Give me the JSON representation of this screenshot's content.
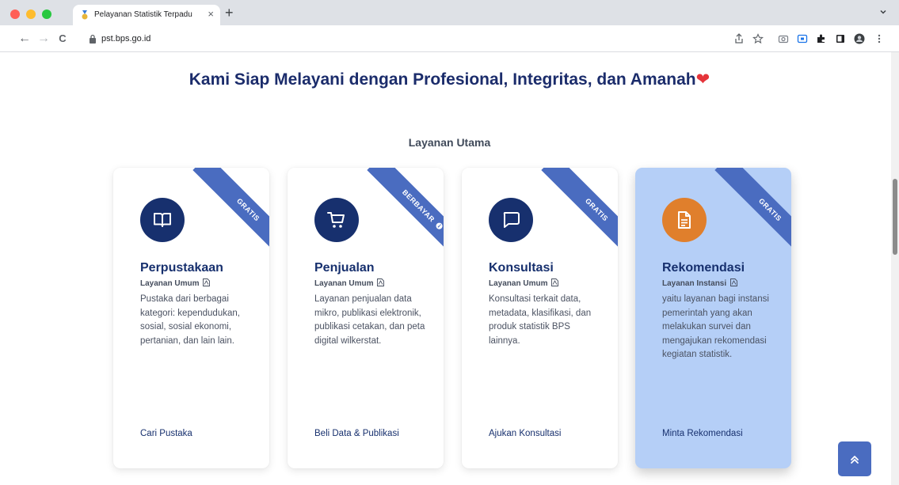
{
  "browser": {
    "tab_title": "Pelayanan Statistik Terpadu",
    "tab_close": "×",
    "new_tab": "+",
    "url": "pst.bps.go.id",
    "back": "←",
    "forward": "→",
    "reload": "C"
  },
  "page": {
    "headline": "Kami Siap Melayani dengan Profesional, Integritas, dan Amanah",
    "headline_emoji": "❤",
    "section_title": "Layanan Utama",
    "back_to_top": "»"
  },
  "cards": [
    {
      "ribbon": "GRATIS",
      "icon": "book-icon",
      "title": "Perpustakaan",
      "subtitle": "Layanan Umum",
      "description": "Pustaka dari berbagai kategori: kependudukan, sosial, sosial ekonomi, pertanian, dan lain lain.",
      "link": "Cari Pustaka"
    },
    {
      "ribbon": "BERBAYAR",
      "icon": "cart-icon",
      "title": "Penjualan",
      "subtitle": "Layanan Umum",
      "description": "Layanan penjualan data mikro, publikasi elektronik, publikasi cetakan, dan peta digital wilkerstat.",
      "link": "Beli Data & Publikasi"
    },
    {
      "ribbon": "GRATIS",
      "icon": "chat-icon",
      "title": "Konsultasi",
      "subtitle": "Layanan Umum",
      "description": "Konsultasi terkait data, metadata, klasifikasi, dan produk statistik BPS lainnya.",
      "link": "Ajukan Konsultasi"
    },
    {
      "ribbon": "GRATIS",
      "icon": "document-icon",
      "title": "Rekomendasi",
      "subtitle": "Layanan Instansi",
      "description": "yaitu layanan bagi instansi pemerintah yang akan melakukan survei dan mengajukan rekomendasi kegiatan statistik.",
      "link": "Minta Rekomendasi"
    }
  ],
  "colors": {
    "navy": "#17306e",
    "ribbon": "#4a6cc0",
    "active_card": "#b5cff7",
    "orange": "#e07f2c"
  }
}
